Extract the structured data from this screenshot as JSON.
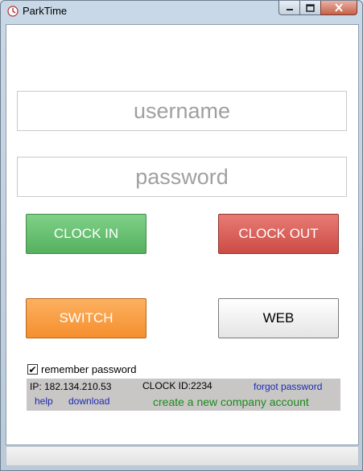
{
  "window": {
    "title": "ParkTime"
  },
  "form": {
    "username_placeholder": "username",
    "password_placeholder": "password"
  },
  "buttons": {
    "clock_in": "CLOCK IN",
    "clock_out": "CLOCK OUT",
    "switch": "SWITCH",
    "web": "WEB"
  },
  "remember": {
    "label": "remember password",
    "checked": true,
    "check_glyph": "✔"
  },
  "info": {
    "ip": "IP: 182.134.210.53",
    "clock_id": "CLOCK ID:2234",
    "forgot_password": "forgot password",
    "help": "help",
    "download": "download",
    "create_account": "create a new company account"
  },
  "colors": {
    "clock_in": "#5cb865",
    "clock_out": "#d9534f",
    "switch": "#f79a3c",
    "link": "#1a2bb0",
    "create_link": "#1c8a1c"
  }
}
